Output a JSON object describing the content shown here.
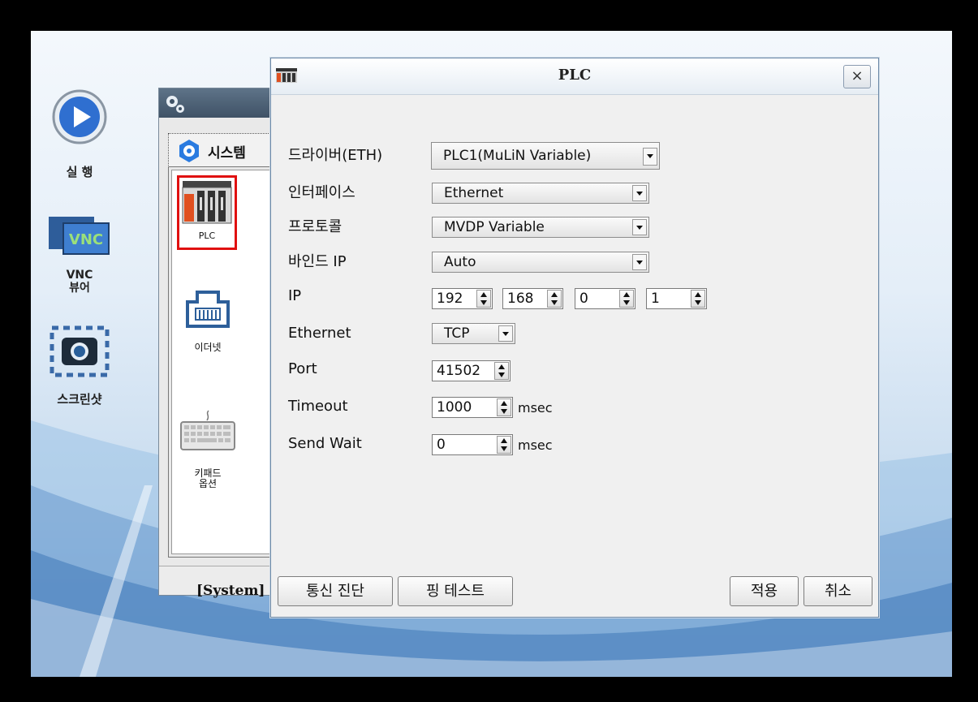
{
  "desktop": {
    "run_label": "실 행",
    "vnc_label": "VNC\n뷰어",
    "vnc_icon_text": "VNC",
    "screenshot_label": "스크린샷"
  },
  "system_window": {
    "tab_label": "시스템",
    "footer_text": "[System]",
    "items": [
      {
        "label": "PLC",
        "selected": true
      },
      {
        "label": "이더넷"
      },
      {
        "label": "키패드\n옵션"
      }
    ]
  },
  "dialog": {
    "title": "PLC",
    "close_glyph": "×",
    "fields": {
      "driver": {
        "label": "드라이버(ETH)",
        "value": "PLC1(MuLiN Variable)"
      },
      "interface": {
        "label": "인터페이스",
        "value": "Ethernet"
      },
      "protocol": {
        "label": "프로토콜",
        "value": "MVDP Variable"
      },
      "bind_ip": {
        "label": "바인드 IP",
        "value": "Auto"
      },
      "ip": {
        "label": "IP",
        "octets": [
          "192",
          "168",
          "0",
          "1"
        ]
      },
      "ethernet": {
        "label": "Ethernet",
        "value": "TCP"
      },
      "port": {
        "label": "Port",
        "value": "41502"
      },
      "timeout": {
        "label": "Timeout",
        "value": "1000",
        "unit": "msec"
      },
      "send_wait": {
        "label": "Send Wait",
        "value": "0",
        "unit": "msec"
      }
    },
    "buttons": {
      "diagnose": "통신 진단",
      "ping": "핑 테스트",
      "apply": "적용",
      "cancel": "취소"
    }
  },
  "colors": {
    "selection_border": "#e01010",
    "titlebar_dark": "#3f5266"
  }
}
